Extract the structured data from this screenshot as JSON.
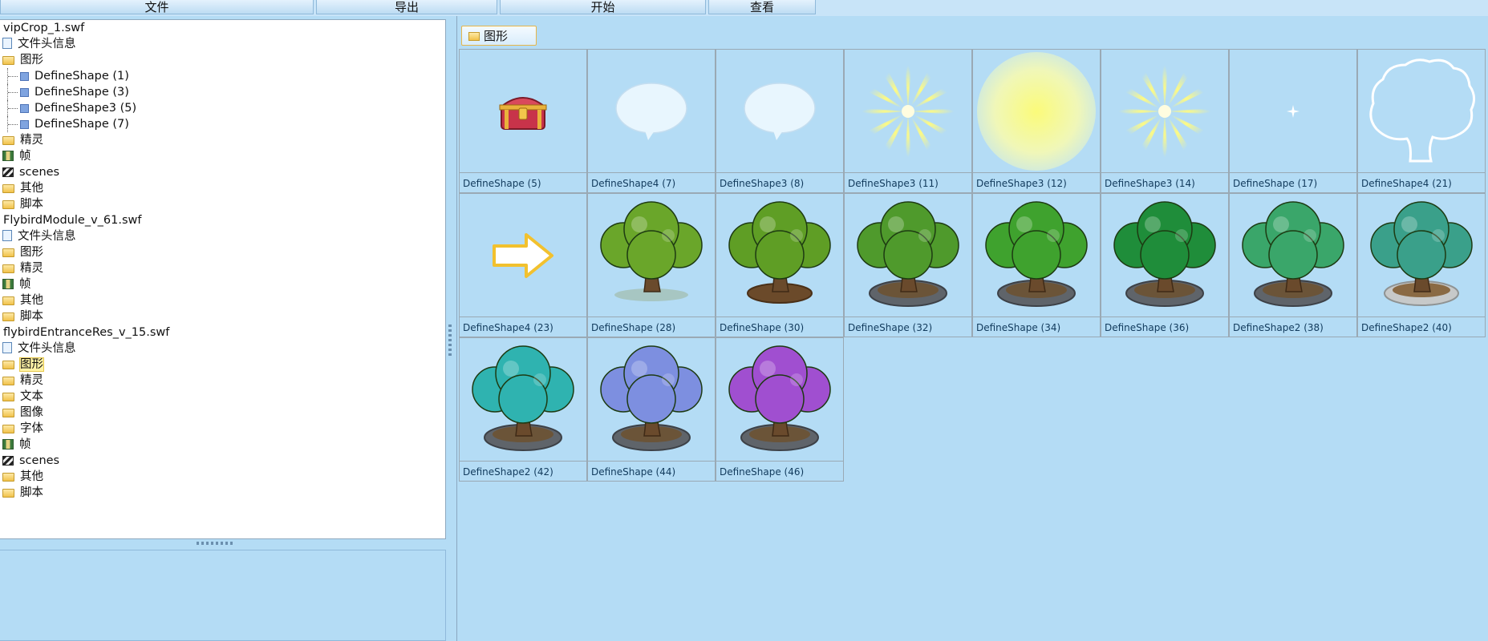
{
  "menu": {
    "items": [
      "文件",
      "导出",
      "开始",
      "查看"
    ]
  },
  "tree": [
    {
      "label": "vipCrop_1.swf",
      "level": 0,
      "icon": "none"
    },
    {
      "label": "文件头信息",
      "level": 0,
      "icon": "doc"
    },
    {
      "label": "图形",
      "level": 0,
      "icon": "folder"
    },
    {
      "label": "DefineShape (1)",
      "level": 1,
      "icon": "shape"
    },
    {
      "label": "DefineShape (3)",
      "level": 1,
      "icon": "shape"
    },
    {
      "label": "DefineShape3 (5)",
      "level": 1,
      "icon": "shape"
    },
    {
      "label": "DefineShape (7)",
      "level": 1,
      "icon": "shape"
    },
    {
      "label": "精灵",
      "level": 0,
      "icon": "folder"
    },
    {
      "label": "帧",
      "level": 0,
      "icon": "film"
    },
    {
      "label": "scenes",
      "level": 0,
      "icon": "clap"
    },
    {
      "label": "其他",
      "level": 0,
      "icon": "folder"
    },
    {
      "label": "脚本",
      "level": 0,
      "icon": "folder"
    },
    {
      "label": "FlybirdModule_v_61.swf",
      "level": 0,
      "icon": "none"
    },
    {
      "label": "文件头信息",
      "level": 0,
      "icon": "doc"
    },
    {
      "label": "图形",
      "level": 0,
      "icon": "folder"
    },
    {
      "label": "精灵",
      "level": 0,
      "icon": "folder"
    },
    {
      "label": "帧",
      "level": 0,
      "icon": "film"
    },
    {
      "label": "其他",
      "level": 0,
      "icon": "folder"
    },
    {
      "label": "脚本",
      "level": 0,
      "icon": "folder"
    },
    {
      "label": "flybirdEntranceRes_v_15.swf",
      "level": 0,
      "icon": "none"
    },
    {
      "label": "文件头信息",
      "level": 0,
      "icon": "doc"
    },
    {
      "label": "图形",
      "level": 0,
      "icon": "folder",
      "selected": true
    },
    {
      "label": "精灵",
      "level": 0,
      "icon": "folder"
    },
    {
      "label": "文本",
      "level": 0,
      "icon": "folder"
    },
    {
      "label": "图像",
      "level": 0,
      "icon": "folder"
    },
    {
      "label": "字体",
      "level": 0,
      "icon": "folder"
    },
    {
      "label": "帧",
      "level": 0,
      "icon": "film"
    },
    {
      "label": "scenes",
      "level": 0,
      "icon": "clap"
    },
    {
      "label": "其他",
      "level": 0,
      "icon": "folder"
    },
    {
      "label": "脚本",
      "level": 0,
      "icon": "folder"
    }
  ],
  "tab": {
    "label": "图形",
    "icon": "folder-icon"
  },
  "shapes": [
    {
      "caption": "DefineShape (5)",
      "kind": "chest"
    },
    {
      "caption": "DefineShape4 (7)",
      "kind": "bubble"
    },
    {
      "caption": "DefineShape3 (8)",
      "kind": "bubble"
    },
    {
      "caption": "DefineShape3 (11)",
      "kind": "rays"
    },
    {
      "caption": "DefineShape3 (12)",
      "kind": "glow"
    },
    {
      "caption": "DefineShape3 (14)",
      "kind": "rays"
    },
    {
      "caption": "DefineShape (17)",
      "kind": "sparkle"
    },
    {
      "caption": "DefineShape4 (21)",
      "kind": "tree-outline"
    },
    {
      "caption": "DefineShape4 (23)",
      "kind": "arrow"
    },
    {
      "caption": "DefineShape (28)",
      "kind": "tree",
      "foliage": "#6aa62a",
      "base": "none"
    },
    {
      "caption": "DefineShape (30)",
      "kind": "tree",
      "foliage": "#5f9e25",
      "base": "brown"
    },
    {
      "caption": "DefineShape (32)",
      "kind": "tree",
      "foliage": "#4f9a2c",
      "base": "stone"
    },
    {
      "caption": "DefineShape (34)",
      "kind": "tree",
      "foliage": "#3fa22e",
      "base": "stone"
    },
    {
      "caption": "DefineShape (36)",
      "kind": "tree",
      "foliage": "#1f8d3a",
      "base": "stone"
    },
    {
      "caption": "DefineShape2 (38)",
      "kind": "tree",
      "foliage": "#3aa66a",
      "base": "stone"
    },
    {
      "caption": "DefineShape2 (40)",
      "kind": "tree",
      "foliage": "#3aa08a",
      "base": "light"
    },
    {
      "caption": "DefineShape2 (42)",
      "kind": "tree",
      "foliage": "#2fb3b0",
      "base": "stone"
    },
    {
      "caption": "DefineShape (44)",
      "kind": "tree",
      "foliage": "#7d8fe0",
      "base": "stone"
    },
    {
      "caption": "DefineShape (46)",
      "kind": "tree",
      "foliage": "#a04fd0",
      "base": "stone"
    }
  ]
}
